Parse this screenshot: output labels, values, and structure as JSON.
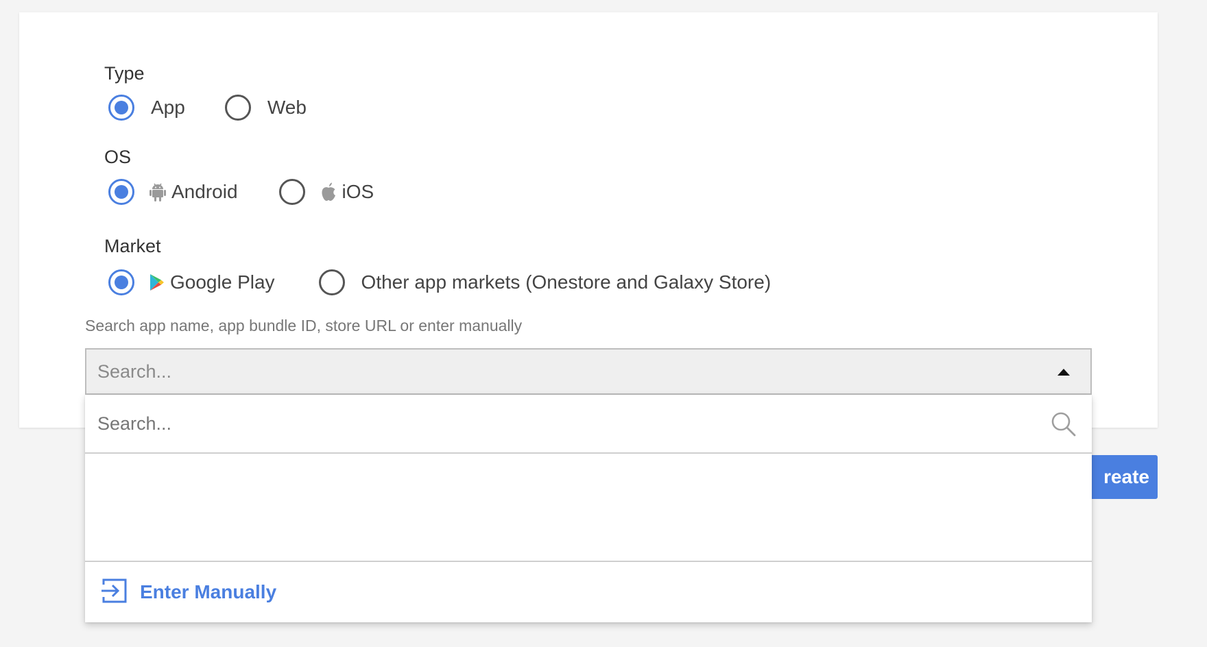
{
  "form": {
    "type": {
      "label": "Type",
      "options": [
        {
          "label": "App",
          "selected": true
        },
        {
          "label": "Web",
          "selected": false
        }
      ]
    },
    "os": {
      "label": "OS",
      "options": [
        {
          "label": "Android",
          "icon": "android-icon",
          "selected": true
        },
        {
          "label": "iOS",
          "icon": "apple-icon",
          "selected": false
        }
      ]
    },
    "market": {
      "label": "Market",
      "options": [
        {
          "label": "Google Play",
          "icon": "google-play-icon",
          "selected": true
        },
        {
          "label": "Other app markets (Onestore and Galaxy Store)",
          "selected": false
        }
      ]
    },
    "search_hint": "Search app name, app bundle ID, store URL or enter manually",
    "select_placeholder": "Search..."
  },
  "dropdown": {
    "search_placeholder": "Search...",
    "search_value": "",
    "enter_manually_label": "Enter Manually"
  },
  "actions": {
    "create_label": "reate"
  },
  "colors": {
    "accent": "#4a7fe0",
    "page_bg": "#f4f4f4",
    "card_bg": "#ffffff",
    "select_bg": "#efefef"
  }
}
